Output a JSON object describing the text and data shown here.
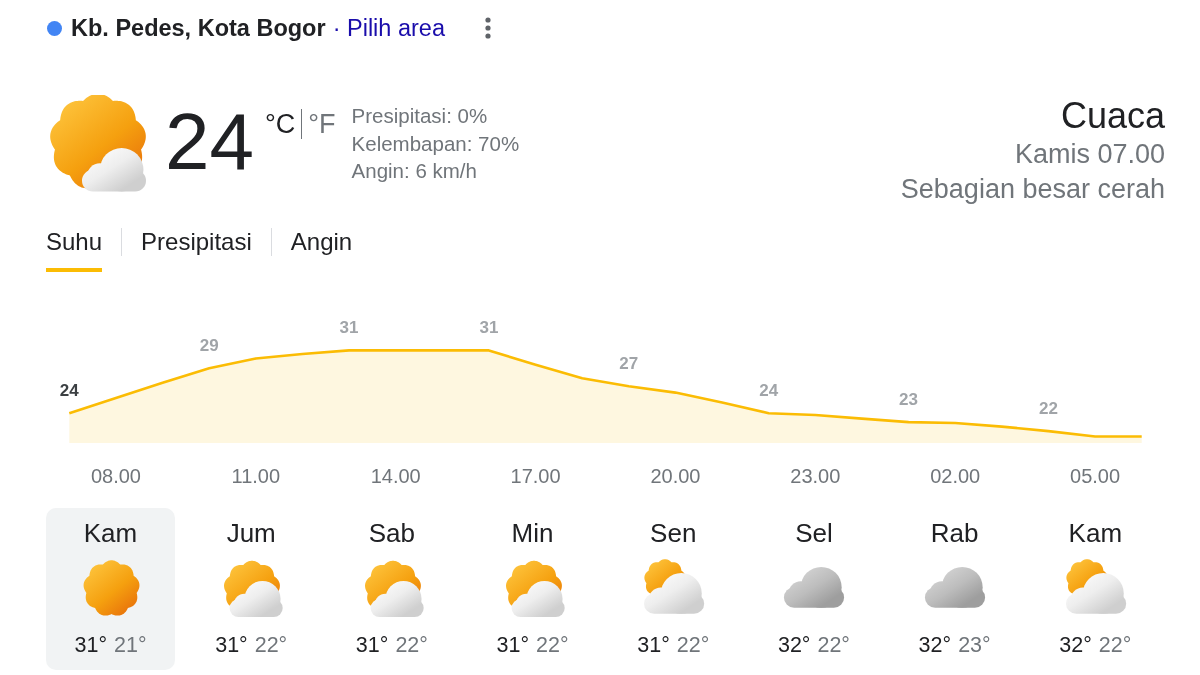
{
  "location": {
    "name": "Kb. Pedes, Kota Bogor",
    "link": "· Pilih area"
  },
  "current": {
    "kind": "mostly_sunny",
    "temperature": "24",
    "units": [
      {
        "label": "°C",
        "selected": true
      },
      {
        "label": "°F",
        "selected": false
      }
    ],
    "details": [
      "Presipitasi: 0%",
      "Kelembapan: 70%",
      "Angin: 6 km/h"
    ]
  },
  "summary": {
    "title": "Cuaca",
    "time": "Kamis 07.00",
    "condition": "Sebagian besar cerah"
  },
  "tabs": [
    {
      "label": "Suhu",
      "selected": true
    },
    {
      "label": "Presipitasi",
      "selected": false
    },
    {
      "label": "Angin",
      "selected": false
    }
  ],
  "chart": {
    "chart_data": {
      "type": "area",
      "categories": [
        null,
        "08.00",
        null,
        null,
        "11.00",
        null,
        null,
        "14.00",
        null,
        null,
        "17.00",
        null,
        null,
        "20.00",
        null,
        null,
        "23.00",
        null,
        null,
        "02.00",
        null,
        null,
        "05.00",
        null
      ],
      "values": [
        24,
        25.7,
        27.4,
        29,
        30.1,
        30.6,
        31,
        31,
        31,
        31,
        29.4,
        27.9,
        27,
        26.3,
        25.2,
        24,
        23.8,
        23.4,
        23,
        22.9,
        22.5,
        22,
        21.4,
        21.4
      ],
      "value_labels": [
        null,
        null,
        null,
        "29",
        null,
        null,
        "31",
        null,
        null,
        "31",
        null,
        null,
        "27",
        null,
        null,
        "24",
        null,
        null,
        "23",
        null,
        null,
        "22",
        null,
        null
      ],
      "annotations": [
        {
          "y": 24,
          "text": "24"
        }
      ]
    }
  },
  "days": [
    {
      "label": "Kam",
      "kind": "sunny",
      "high": "31°",
      "low": "21°",
      "selected": true
    },
    {
      "label": "Jum",
      "kind": "partly_cloudy",
      "high": "31°",
      "low": "22°",
      "selected": false
    },
    {
      "label": "Sab",
      "kind": "partly_cloudy",
      "high": "31°",
      "low": "22°",
      "selected": false
    },
    {
      "label": "Min",
      "kind": "partly_cloudy",
      "high": "31°",
      "low": "22°",
      "selected": false
    },
    {
      "label": "Sen",
      "kind": "mostly_cloudy",
      "high": "31°",
      "low": "22°",
      "selected": false
    },
    {
      "label": "Sel",
      "kind": "cloudy",
      "high": "32°",
      "low": "22°",
      "selected": false
    },
    {
      "label": "Rab",
      "kind": "cloudy",
      "high": "32°",
      "low": "23°",
      "selected": false
    },
    {
      "label": "Kam",
      "kind": "mostly_cloudy",
      "high": "32°",
      "low": "22°",
      "selected": false
    }
  ]
}
